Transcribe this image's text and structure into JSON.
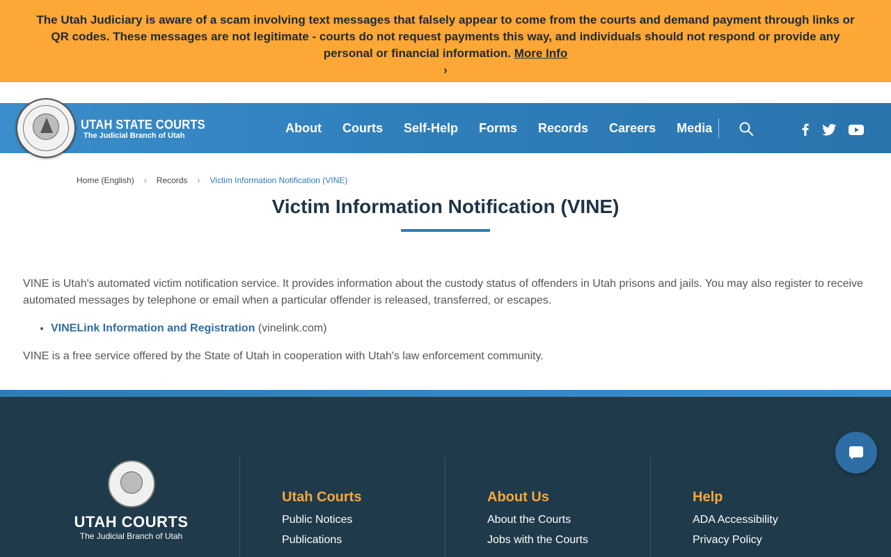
{
  "alert": {
    "text": "The Utah Judiciary is aware of a scam involving text messages that falsely appear to come from the courts and demand payment through links or QR codes. These messages are not legitimate - courts do not request payments this way, and individuals should not respond or provide any personal or financial information.",
    "link_label": "More Info",
    "chevron": "›"
  },
  "header": {
    "brand_title": "UTAH STATE COURTS",
    "brand_subtitle": "The Judicial Branch of Utah",
    "nav": [
      "About",
      "Courts",
      "Self-Help",
      "Forms",
      "Records",
      "Careers",
      "Media"
    ],
    "social_icons": [
      "facebook-icon",
      "twitter-icon",
      "youtube-icon"
    ]
  },
  "breadcrumb": {
    "items": [
      "Home (English)",
      "Records",
      "Victim Information Notification (VINE)"
    ],
    "separator": "›"
  },
  "page": {
    "title": "Victim Information Notification (VINE)",
    "para1": "VINE is Utah's automated victim notification service. It provides information about the custody status of offenders in Utah prisons and jails. You may also register to receive automated messages by telephone or email when a particular offender is released, transferred, or escapes.",
    "link_label": "VINELink Information and Registration",
    "link_suffix": " (vinelink.com)",
    "para2": "VINE is a free service offered by the State of Utah in cooperation with Utah's law enforcement community."
  },
  "footer": {
    "brand_title": "UTAH COURTS",
    "brand_subtitle": "The Judicial Branch of Utah",
    "columns": [
      {
        "heading": "Utah Courts",
        "links": [
          "Public Notices",
          "Publications"
        ]
      },
      {
        "heading": "About Us",
        "links": [
          "About the Courts",
          "Jobs with the Courts"
        ]
      },
      {
        "heading": "Help",
        "links": [
          "ADA Accessibility",
          "Privacy Policy"
        ]
      }
    ]
  },
  "colors": {
    "alert_bg": "#fda736",
    "header_blue": "#2f7fbb",
    "footer_bg": "#1f3a4a",
    "footer_heading": "#f7a83b",
    "link_blue": "#2f6ea5"
  }
}
